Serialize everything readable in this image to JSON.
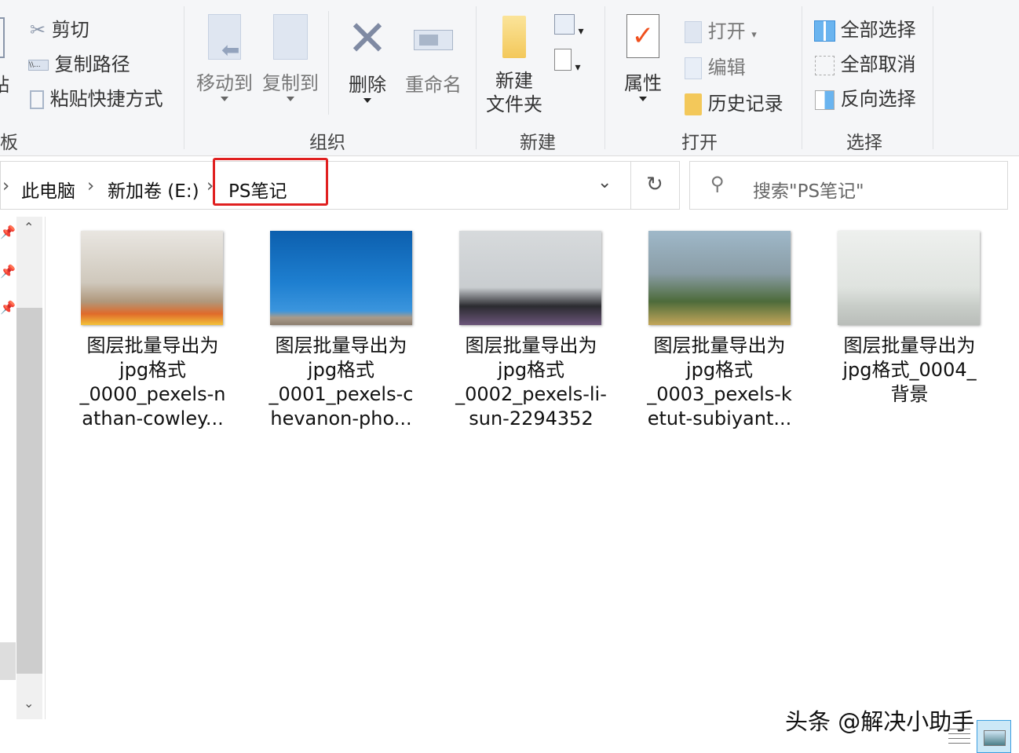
{
  "ribbon": {
    "clipboard": {
      "cut": "剪切",
      "copy_path": "复制路径",
      "paste_shortcut": "粘贴快捷方式",
      "paste_partial": "贴",
      "group_partial": "板"
    },
    "organize": {
      "move_to": "移动到",
      "copy_to": "复制到",
      "delete": "删除",
      "rename": "重命名",
      "group": "组织"
    },
    "new": {
      "new_folder_line1": "新建",
      "new_folder_line2": "文件夹",
      "group": "新建"
    },
    "open": {
      "properties": "属性",
      "open": "打开",
      "edit": "编辑",
      "history": "历史记录",
      "group": "打开"
    },
    "select": {
      "select_all": "全部选择",
      "select_none": "全部取消",
      "invert": "反向选择",
      "group": "选择"
    }
  },
  "address": {
    "crumbs": [
      "此电脑",
      "新加卷 (E:)",
      "PS笔记"
    ],
    "highlight_color": "#e02020"
  },
  "search": {
    "placeholder": "搜索\"PS笔记\""
  },
  "files": [
    {
      "lines": [
        "图层批量导出为",
        "jpg格式",
        "_0000_pexels-n",
        "athan-cowley..."
      ]
    },
    {
      "lines": [
        "图层批量导出为",
        "jpg格式",
        "_0001_pexels-c",
        "hevanon-pho..."
      ]
    },
    {
      "lines": [
        "图层批量导出为",
        "jpg格式",
        "_0002_pexels-li-",
        "sun-2294352"
      ]
    },
    {
      "lines": [
        "图层批量导出为",
        "jpg格式",
        "_0003_pexels-k",
        "etut-subiyant..."
      ]
    },
    {
      "lines": [
        "图层批量导出为",
        "jpg格式_0004_",
        "背景"
      ]
    }
  ],
  "watermark": "头条 @解决小助手"
}
